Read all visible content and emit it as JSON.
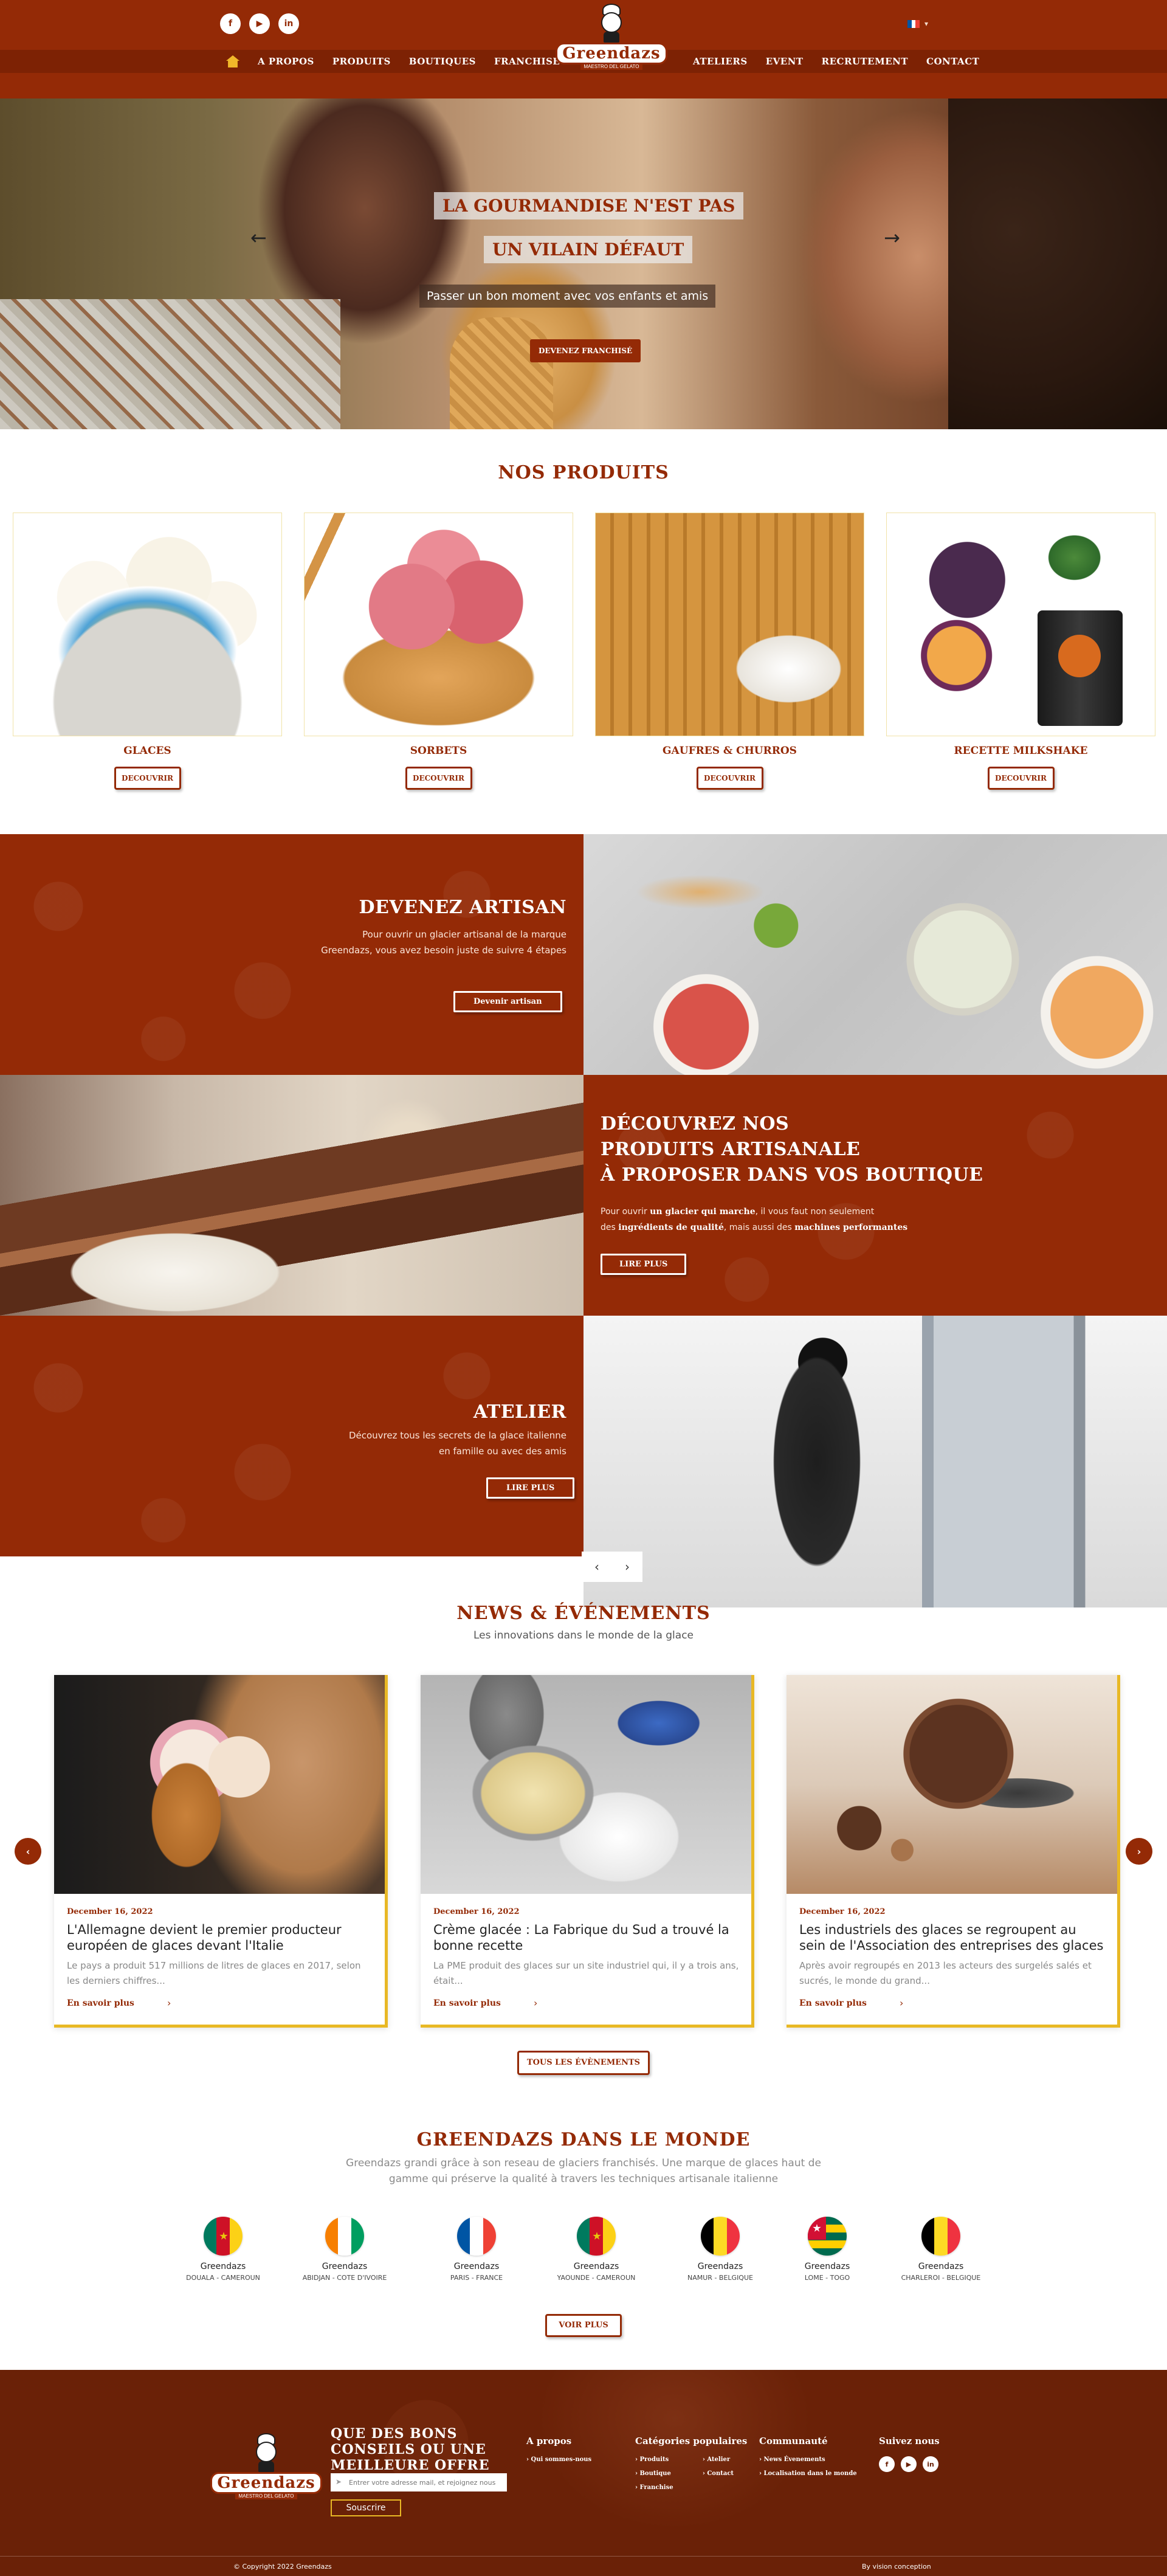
{
  "header": {
    "social": [
      "f",
      "▶",
      "in"
    ],
    "language": "▾",
    "nav_left": [
      "A PROPOS",
      "PRODUITS",
      "BOUTIQUES",
      "FRANCHISE"
    ],
    "nav_right": [
      "ATELIERS",
      "EVENT",
      "RECRUTEMENT",
      "CONTACT"
    ],
    "logo_text": "Greendazs",
    "logo_sub": "MAESTRO DEL GELATO",
    "icons": [
      "home-icon",
      "facebook-icon",
      "youtube-icon",
      "linkedin-icon",
      "france-flag-icon"
    ]
  },
  "hero": {
    "title_line1": "LA GOURMANDISE N'EST PAS",
    "title_line2": "UN VILAIN DÉFAUT",
    "subtitle": "Passer un bon moment avec vos enfants et amis",
    "cta": "DEVENEZ FRANCHISÉ",
    "prev": "←",
    "next": "→"
  },
  "products": {
    "title": "NOS PRODUITS",
    "items": [
      {
        "name": "GLACES",
        "button": "DECOUVRIR"
      },
      {
        "name": "SORBETS",
        "button": "DECOUVRIR"
      },
      {
        "name": "GAUFRES & CHURROS",
        "button": "DECOUVRIR"
      },
      {
        "name": "RECETTE MILKSHAKE",
        "button": "DECOUVRIR"
      }
    ]
  },
  "artisan": {
    "title": "DEVENEZ ARTISAN",
    "text_line1": "Pour ouvrir un glacier artisanal de la marque",
    "text_line2": "Greendazs, vous avez besoin juste de suivre 4 étapes",
    "button": "Devenir artisan"
  },
  "discover": {
    "title_line1": "DÉCOUVREZ NOS",
    "title_line2": "PRODUITS ARTISANALE",
    "title_line3": "À PROPOSER DANS VOS BOUTIQUE",
    "p1_pre": "Pour ouvrir ",
    "p1_bold": "un glacier qui marche",
    "p1_post": ", il vous faut non seulement",
    "p2_pre": "des ",
    "p2_bold1": "ingrédients de qualité",
    "p2_mid": ", mais aussi des ",
    "p2_bold2": "machines performantes",
    "button": "LIRE PLUS"
  },
  "atelier": {
    "title": "ATELIER",
    "text_line1": "Découvrez tous les secrets de la glace italienne",
    "text_line2": "en famille ou avec des amis",
    "button": "LIRE PLUS",
    "prev": "‹",
    "next": "›"
  },
  "news": {
    "title": "NEWS & ÉVÉNEMENTS",
    "subtitle": "Les innovations dans le monde de la glace",
    "items": [
      {
        "date": "December 16, 2022",
        "title": "L'Allemagne devient le premier producteur européen de glaces devant l'Italie",
        "excerpt": "Le pays a produit 517 millions de litres de glaces en 2017, selon les derniers chiffres...",
        "more": "En savoir plus",
        "arrow": "›"
      },
      {
        "date": "December 16, 2022",
        "title": "Crème glacée : La Fabrique du Sud a trouvé la bonne recette",
        "excerpt": "La PME produit des glaces sur un site industriel qui, il y a trois ans, était...",
        "more": "En savoir plus",
        "arrow": "›"
      },
      {
        "date": "December 16, 2022",
        "title": "Les industriels des glaces se regroupent au sein de l'Association des entreprises des glaces",
        "excerpt": "Après avoir regroupés en 2013 les acteurs des surgelés salés et sucrés, le monde du grand...",
        "more": "En savoir plus",
        "arrow": "›"
      }
    ],
    "prev": "‹",
    "next": "›",
    "all_button": "TOUS LES ÉVÈNEMENTS"
  },
  "world": {
    "title": "GREENDAZS DANS LE MONDE",
    "text_line1": "Greendazs grandi grâce à son reseau de glaciers franchisés. Une marque de glaces haut de",
    "text_line2": "gamme qui préserve la qualité à travers les techniques artisanale italienne",
    "locations": [
      {
        "name": "Greendazs",
        "place": "DOUALA - CAMEROUN",
        "flag": "cameroon",
        "colors": [
          "#007a5e",
          "#ce1126",
          "#fcd116"
        ]
      },
      {
        "name": "Greendazs",
        "place": "ABIDJAN - COTE D'IVOIRE",
        "flag": "ivory-coast",
        "colors": [
          "#f77f00",
          "#ffffff",
          "#009e60"
        ]
      },
      {
        "name": "Greendazs",
        "place": "PARIS - FRANCE",
        "flag": "france",
        "colors": [
          "#0055a4",
          "#ffffff",
          "#ef4135"
        ]
      },
      {
        "name": "Greendazs",
        "place": "YAOUNDE - CAMEROUN",
        "flag": "cameroon",
        "colors": [
          "#007a5e",
          "#ce1126",
          "#fcd116"
        ]
      },
      {
        "name": "Greendazs",
        "place": "NAMUR - BELGIQUE",
        "flag": "belgium",
        "colors": [
          "#000000",
          "#fdda24",
          "#ef3340"
        ]
      },
      {
        "name": "Greendazs",
        "place": "LOME - TOGO",
        "flag": "togo",
        "colors": [
          "#006a4e",
          "#ffce00",
          "#d21034"
        ]
      },
      {
        "name": "Greendazs",
        "place": "CHARLEROI - BELGIQUE",
        "flag": "belgium",
        "colors": [
          "#000000",
          "#fdda24",
          "#ef3340"
        ]
      }
    ],
    "button": "VOIR PLUS"
  },
  "footer": {
    "headline_line1": "QUE DES BONS",
    "headline_line2": "CONSEILS OU UNE",
    "headline_line3": "MEILLEURE OFFRE",
    "email_placeholder": "Entrer votre adresse mail, et rejoignez nous",
    "email_icon": "➤",
    "subscribe": "Souscrire",
    "col_about": {
      "title": "A propos",
      "links": [
        "Qui sommes-nous"
      ]
    },
    "col_categories": {
      "title": "Catégories populaires",
      "links": [
        "Produits",
        "Atelier",
        "Boutique",
        "Contact",
        "Franchise"
      ]
    },
    "col_community": {
      "title": "Communauté",
      "links": [
        "News Évenements",
        "Localisation dans le monde"
      ]
    },
    "col_follow": {
      "title": "Suivez nous",
      "icons": [
        "f",
        "▶",
        "in"
      ]
    },
    "copyright": "© Copyright 2022 Greendazs",
    "by": "By vision conception"
  },
  "colors": {
    "brand": "#942a06",
    "brand_dark": "#6a2107",
    "accent": "#e8b825",
    "white": "#ffffff"
  }
}
